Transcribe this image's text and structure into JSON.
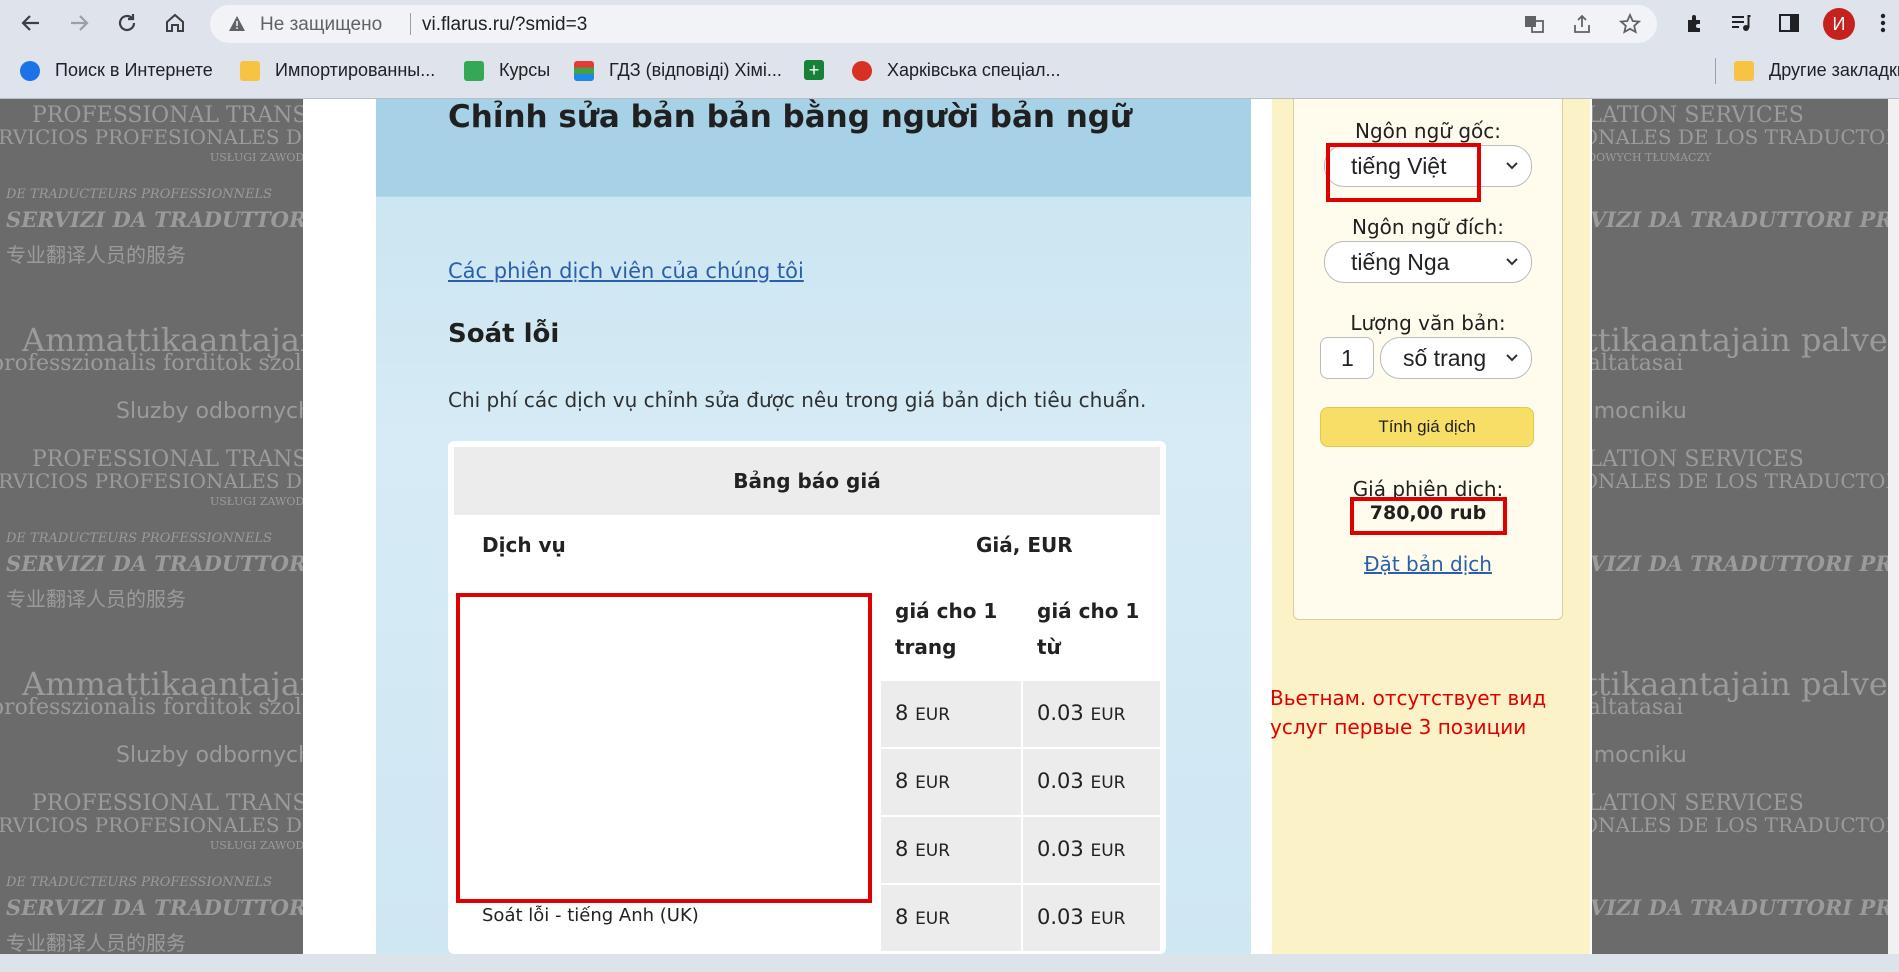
{
  "browser": {
    "security_label": "Не защищено",
    "url": "vi.flarus.ru/?smid=3",
    "avatar_letter": "И"
  },
  "bookmarks": [
    {
      "label": "Поиск в Интернете"
    },
    {
      "label": "Импортированны..."
    },
    {
      "label": "Курсы"
    },
    {
      "label": "ГДЗ (відповіді) Хімі..."
    },
    {
      "label": ""
    },
    {
      "label": "Харківська спеціал..."
    }
  ],
  "bookmarks_other": "Другие закладки",
  "watermark": {
    "line1": "PROFESSIONAL TRANSLATION SERVICES",
    "line2": "SERVICIOS PROFESIONALES DE LOS TRADUCTORES",
    "line3": "USŁUGI ZAWODOWYCH TŁUMACZY",
    "line4": "DE TRADUCTEURS PROFESSIONNELS",
    "line5": "SERVIZI DA TRADUTTORI PROFESSIONISTI",
    "line6": "专业翻译人员的服务",
    "line7": "Ammattikaantajain palvelut",
    "line8": "professzionalis forditok szolgaltatasai",
    "line9": "Sluzby odbornych tlumocniku"
  },
  "main": {
    "title": "Chỉnh sửa bản bản bằng người bản ngữ",
    "translators_link": "Các phiên dịch viên của chúng tôi",
    "section_title": "Soát lỗi",
    "description": "Chi phí các dịch vụ chỉnh sửa được nêu trong giá bản dịch tiêu chuẩn."
  },
  "price_table": {
    "title": "Bảng báo giá",
    "col_service": "Dịch vụ",
    "col_price": "Giá, EUR",
    "col_per_page": "giá cho 1 trang",
    "col_per_word": "giá cho 1 từ",
    "currency": "EUR",
    "rows": [
      {
        "service": "",
        "per_page": "8",
        "per_word": "0.03"
      },
      {
        "service": "",
        "per_page": "8",
        "per_word": "0.03"
      },
      {
        "service": "",
        "per_page": "8",
        "per_word": "0.03"
      },
      {
        "service": "Soát lỗi - tiếng Anh (UK)",
        "per_page": "8",
        "per_word": "0.03"
      }
    ]
  },
  "calculator": {
    "source_label": "Ngôn ngữ gốc:",
    "source_value": "tiếng Việt",
    "target_label": "Ngôn ngữ đích:",
    "target_value": "tiếng Nga",
    "volume_label": "Lượng văn bản:",
    "volume_value": "1",
    "unit_value": "số trang",
    "calc_button": "Tính giá dịch",
    "price_label": "Giá phiên dịch:",
    "price_value": "780,00 rub",
    "order_link": "Đặt bản dịch"
  },
  "annotation": {
    "text": "Вьетнам. отсутствует вид услуг первые 3 позиции"
  }
}
